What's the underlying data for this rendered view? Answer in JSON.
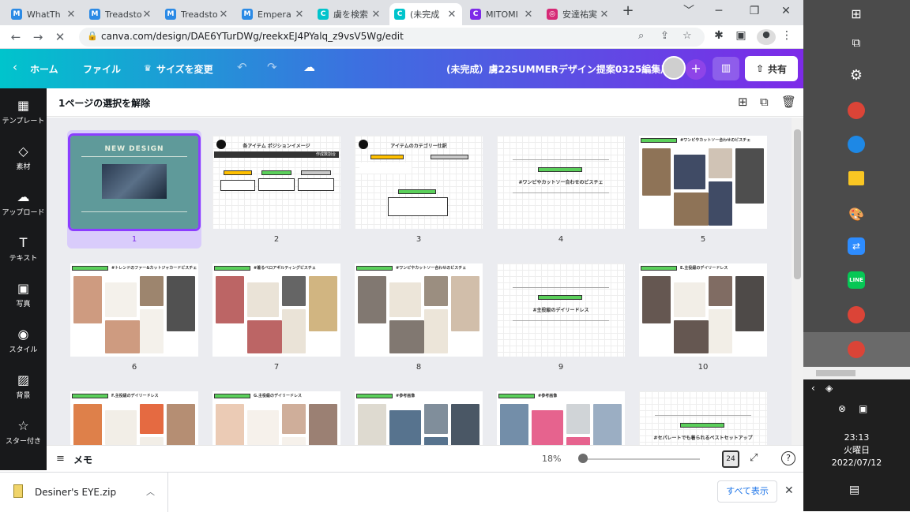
{
  "browser": {
    "tabs": [
      {
        "title": "WhatTh",
        "icon": "M",
        "color": "#2b8ae5"
      },
      {
        "title": "Treadsto",
        "icon": "M",
        "color": "#2b8ae5"
      },
      {
        "title": "Treadsto",
        "icon": "M",
        "color": "#2b8ae5"
      },
      {
        "title": "Empera",
        "icon": "M",
        "color": "#2b8ae5"
      },
      {
        "title": "虜を検索",
        "icon": "C",
        "color": "#00c4cc"
      },
      {
        "title": "(未完成",
        "icon": "C",
        "color": "#00c4cc"
      },
      {
        "title": "MITOMI",
        "icon": "C",
        "color": "#7d2ae8"
      },
      {
        "title": "安達祐実",
        "icon": "◎",
        "color": "#d62976"
      }
    ],
    "url": "canva.com/design/DAE6YTurDWg/reekxEJ4PYalq_z9vsV5Wg/edit"
  },
  "canva": {
    "home": "ホーム",
    "file": "ファイル",
    "resize": "サイズを変更",
    "doc_title": "(未完成）虜22SUMMERデザイン提案0325編集用",
    "share": "共有",
    "deselect": "1ページの選択を解除",
    "memo": "メモ",
    "zoom": "18%",
    "page_count_icon": "24"
  },
  "sidebar": [
    {
      "icon": "▦",
      "label": "テンプレート"
    },
    {
      "icon": "◇",
      "label": "素材"
    },
    {
      "icon": "☁",
      "label": "アップロード"
    },
    {
      "icon": "T",
      "label": "テキスト"
    },
    {
      "icon": "▣",
      "label": "写真"
    },
    {
      "icon": "◉",
      "label": "スタイル"
    },
    {
      "icon": "▨",
      "label": "背景"
    },
    {
      "icon": "☆",
      "label": "スター付き"
    }
  ],
  "pages": [
    {
      "num": "1",
      "type": "cover",
      "title": "NEW DESIGN"
    },
    {
      "num": "2",
      "type": "position",
      "title": "各アイテム ポジションイメージ",
      "badge": "作成数割合"
    },
    {
      "num": "3",
      "type": "category",
      "title": "アイテムのカテゴリー仕訳"
    },
    {
      "num": "4",
      "type": "text",
      "title": "#ワンピやカットソー合わせのビスチェ"
    },
    {
      "num": "5",
      "type": "photo",
      "title": "#ワンピやカットソー合わせのビスチェ"
    },
    {
      "num": "6",
      "type": "photo",
      "title": "#トレンドのファー&カットジャカードビスチェ"
    },
    {
      "num": "7",
      "type": "photo",
      "title": "#着るべロアギルティングビスチェ"
    },
    {
      "num": "8",
      "type": "photo",
      "title": "#ワンピやカットソー合わせのビスチェ"
    },
    {
      "num": "9",
      "type": "text",
      "title": "#主役級のデイリードレス"
    },
    {
      "num": "10",
      "type": "photo",
      "title": "E.主役級のデイリードレス"
    },
    {
      "num": "",
      "type": "photo",
      "title": "F.主役級のデイリードレス"
    },
    {
      "num": "",
      "type": "photo",
      "title": "G.主役級のデイリードレス"
    },
    {
      "num": "",
      "type": "photo",
      "title": "#参考画像"
    },
    {
      "num": "",
      "type": "photo",
      "title": "#参考画像"
    },
    {
      "num": "",
      "type": "text",
      "title": "#セパレートでも着られるベストセットアップ"
    }
  ],
  "downloads": {
    "file": "Desiner's EYE.zip",
    "show_all": "すべて表示"
  },
  "taskbar": {
    "time": "23:13",
    "day": "火曜日",
    "date": "2022/07/12"
  }
}
